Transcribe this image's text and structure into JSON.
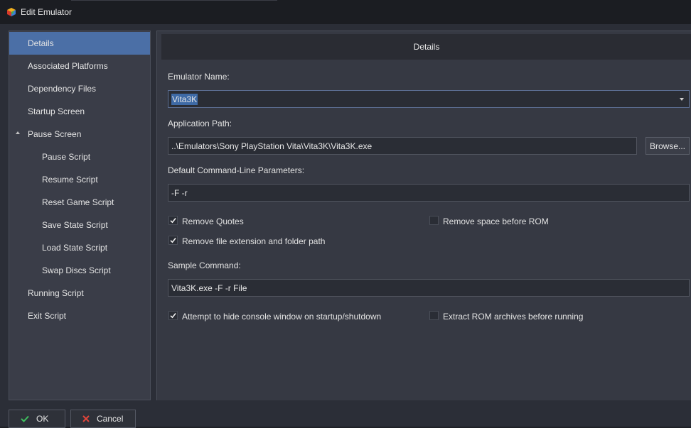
{
  "window": {
    "title": "Edit Emulator",
    "app_icon": "launchbox-cube-icon"
  },
  "sidebar": {
    "items": [
      {
        "label": "Details",
        "selected": true
      },
      {
        "label": "Associated Platforms"
      },
      {
        "label": "Dependency Files"
      },
      {
        "label": "Startup Screen"
      },
      {
        "label": "Pause Screen",
        "expanded": true
      },
      {
        "label": "Pause Script",
        "child": true
      },
      {
        "label": "Resume Script",
        "child": true
      },
      {
        "label": "Reset Game Script",
        "child": true
      },
      {
        "label": "Save State Script",
        "child": true
      },
      {
        "label": "Load State Script",
        "child": true
      },
      {
        "label": "Swap Discs Script",
        "child": true
      },
      {
        "label": "Running Script"
      },
      {
        "label": "Exit Script"
      }
    ]
  },
  "details": {
    "header": "Details",
    "emulator_name_label": "Emulator Name:",
    "emulator_name_value": "Vita3K",
    "application_path_label": "Application Path:",
    "application_path_value": "..\\Emulators\\Sony PlayStation Vita\\Vita3K\\Vita3K.exe",
    "browse_label": "Browse...",
    "cmdline_label": "Default Command-Line Parameters:",
    "cmdline_value": "-F -r",
    "remove_quotes_label": "Remove Quotes",
    "remove_quotes_checked": true,
    "remove_space_label": "Remove space before ROM",
    "remove_space_checked": false,
    "remove_ext_label": "Remove file extension and folder path",
    "remove_ext_checked": true,
    "sample_command_label": "Sample Command:",
    "sample_command_value": "Vita3K.exe -F -r File",
    "hide_console_label": "Attempt to hide console window on startup/shutdown",
    "hide_console_checked": true,
    "extract_rom_label": "Extract ROM archives before running",
    "extract_rom_checked": false
  },
  "footer": {
    "ok_label": "OK",
    "cancel_label": "Cancel"
  },
  "colors": {
    "selected_item": "#4b6fa6",
    "ok_check": "#3fbf5f",
    "cancel_x": "#e0453a"
  }
}
